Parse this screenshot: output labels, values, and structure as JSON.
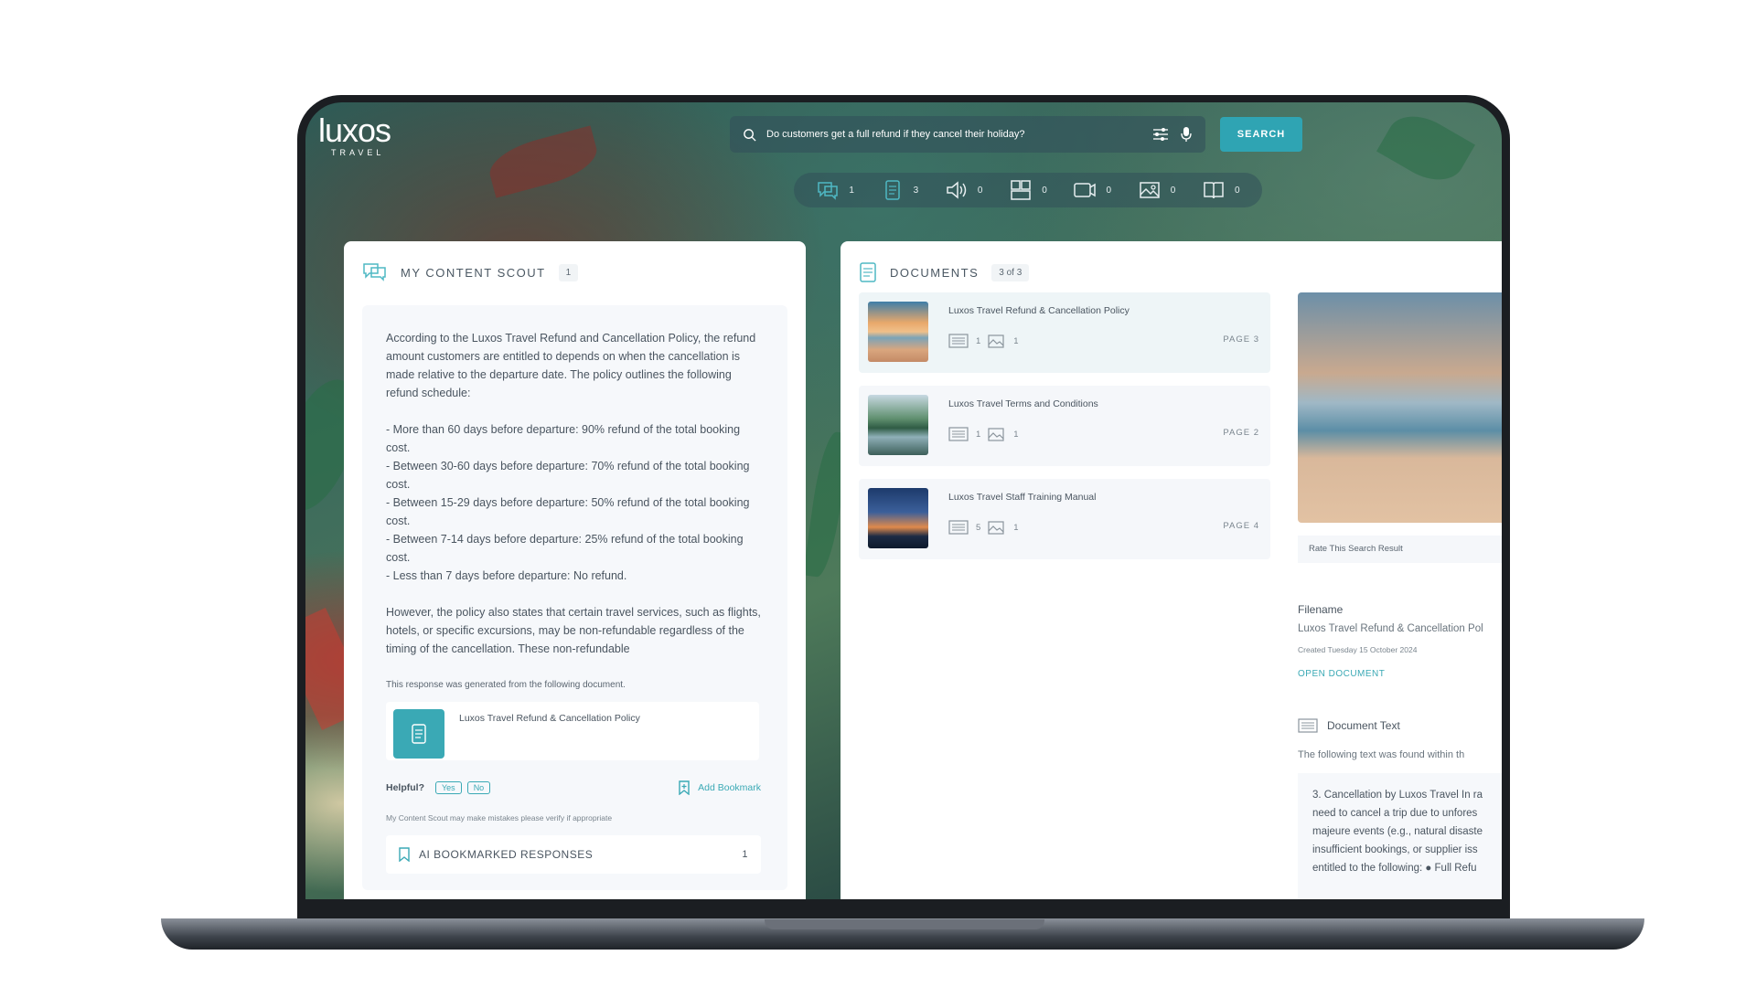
{
  "app": {
    "logo_word": "luxos",
    "logo_sub": "TRAVEL"
  },
  "search": {
    "query": "Do customers get a full refund if they cancel their holiday?",
    "button_label": "SEARCH"
  },
  "filters": [
    {
      "icon": "scout-icon",
      "count": "1"
    },
    {
      "icon": "document-icon",
      "count": "3"
    },
    {
      "icon": "audio-icon",
      "count": "0"
    },
    {
      "icon": "layout-icon",
      "count": "0"
    },
    {
      "icon": "video-icon",
      "count": "0"
    },
    {
      "icon": "image-icon",
      "count": "0"
    },
    {
      "icon": "book-icon",
      "count": "0"
    }
  ],
  "scout": {
    "title": "MY CONTENT SCOUT",
    "count": "1",
    "answer": "According to the Luxos Travel Refund and Cancellation Policy, the refund amount customers are entitled to depends on when the cancellation is made relative to the departure date. The policy outlines the following refund schedule:\n\n- More than 60 days before departure: 90% refund of the total booking cost.\n- Between 30-60 days before departure: 70% refund of the total booking cost.\n- Between 15-29 days before departure: 50% refund of the total booking cost.\n- Between 7-14 days before departure: 25% refund of the total booking cost.\n- Less than 7 days before departure: No refund.\n\nHowever, the policy also states that certain travel services, such as flights, hotels, or specific excursions, may be non-refundable regardless of the timing of the cancellation. These non-refundable",
    "source_note": "This response was generated from the following document.",
    "source_doc": "Luxos Travel Refund & Cancellation Policy",
    "helpful_label": "Helpful?",
    "yes_label": "Yes",
    "no_label": "No",
    "add_bookmark": "Add Bookmark",
    "disclaimer": "My Content Scout may make mistakes please verify if appropriate",
    "bookmarked_label": "AI BOOKMARKED RESPONSES",
    "bookmarked_count": "1"
  },
  "documents": {
    "title": "DOCUMENTS",
    "count": "3 of 3",
    "items": [
      {
        "title": "Luxos Travel Refund & Cancellation Policy",
        "text_count": "1",
        "image_count": "1",
        "page": "PAGE 3"
      },
      {
        "title": "Luxos Travel Terms and Conditions",
        "text_count": "1",
        "image_count": "1",
        "page": "PAGE 2"
      },
      {
        "title": "Luxos Travel Staff Training Manual",
        "text_count": "5",
        "image_count": "1",
        "page": "PAGE 4"
      }
    ]
  },
  "preview": {
    "rate_label": "Rate This Search Result",
    "filename_label": "Filename",
    "filename": "Luxos Travel Refund & Cancellation Pol",
    "created": "Created Tuesday 15 October 2024",
    "open_label": "OPEN DOCUMENT",
    "doc_text_label": "Document Text",
    "doc_text_sub": "The following text was found within th",
    "doc_text_lines": [
      "3. Cancellation by Luxos Travel In ra",
      "need to cancel a trip due to unfores",
      "majeure events (e.g., natural disaste",
      "insufficient bookings, or supplier iss",
      "entitled to the following: ● Full Refu"
    ]
  },
  "colors": {
    "accent": "#3aa9b5",
    "search_button": "#2fa4b3"
  }
}
